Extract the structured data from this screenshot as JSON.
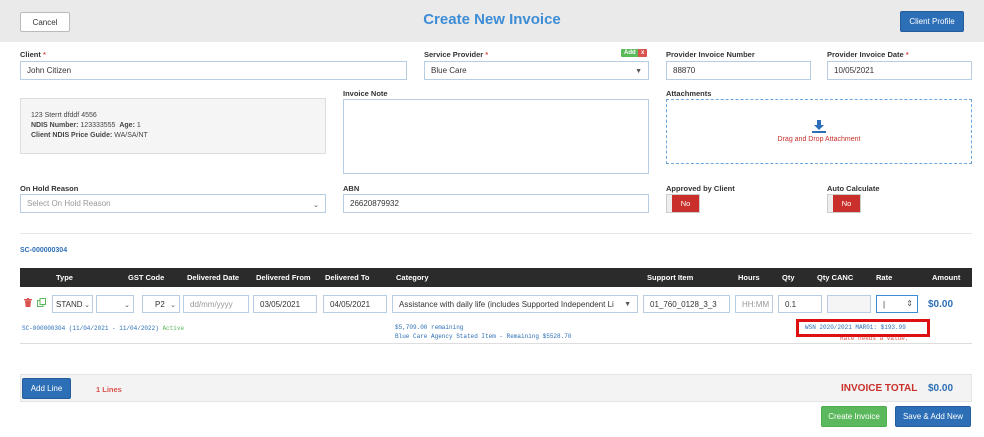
{
  "header": {
    "cancel_label": "Cancel",
    "title": "Create New Invoice",
    "client_profile_label": "Client Profile"
  },
  "form": {
    "client_label": "Client",
    "client_value": "John Citizen",
    "service_provider_label": "Service Provider",
    "service_provider_value": "Blue Care",
    "add_badge": "Add",
    "remove_badge": "x",
    "provider_invoice_number_label": "Provider Invoice Number",
    "provider_invoice_number_value": "88870",
    "provider_invoice_date_label": "Provider Invoice Date",
    "provider_invoice_date_value": "10/05/2021",
    "client_address": "123 Sterrt dfddf 4556",
    "ndis_number_label": "NDIS Number:",
    "ndis_number_value": "123333555",
    "age_label": "Age:",
    "age_value": "1",
    "price_guide_label": "Client NDIS Price Guide:",
    "price_guide_value": "WA/SA/NT",
    "invoice_note_label": "Invoice Note",
    "attachments_label": "Attachments",
    "drag_drop_text": "Drag and Drop Attachment",
    "on_hold_reason_label": "On Hold Reason",
    "on_hold_reason_placeholder": "Select On Hold Reason",
    "abn_label": "ABN",
    "abn_value": "26620879932",
    "approved_by_client_label": "Approved by Client",
    "approved_by_client_value": "No",
    "auto_calculate_label": "Auto Calculate",
    "auto_calculate_value": "No"
  },
  "service_agreement_link": "SC-000000304",
  "table": {
    "headers": {
      "type": "Type",
      "gst_code": "GST Code",
      "delivered_date": "Delivered Date",
      "delivered_from": "Delivered From",
      "delivered_to": "Delivered To",
      "category": "Category",
      "support_item": "Support Item",
      "hours": "Hours",
      "qty": "Qty",
      "qty_canc": "Qty CANC",
      "rate": "Rate",
      "amount": "Amount"
    },
    "row": {
      "type_value": "STAND",
      "gst_code_value": "P2",
      "delivered_date_placeholder": "dd/mm/yyyy",
      "delivered_from_value": "03/05/2021",
      "delivered_to_value": "04/05/2021",
      "category_value": "Assistance with daily life (includes Supported Independent Li",
      "support_item_value": "01_760_0128_3_3",
      "hours_placeholder": "HH:MM",
      "qty_value": "0.1",
      "rate_value": "|",
      "amount_value": "$0.00",
      "agreement_info": "SC-000000304 (11/04/2021 - 11/04/2022)",
      "agreement_status": "Active",
      "remaining_text": "$5,709.00 remaining",
      "stated_item_text": "Blue Care Agency Stated Item - Remaining $5528.70",
      "price_guide_text": "WSN 2020/2021 MAR01: $193.99",
      "rate_error_text": "Rate needs a value."
    }
  },
  "footer": {
    "add_line_label": "Add Line",
    "lines_count": "1 Lines",
    "invoice_total_label": "INVOICE TOTAL",
    "invoice_total_value": "$0.00",
    "create_invoice_label": "Create Invoice",
    "save_add_new_label": "Save & Add New"
  },
  "colors": {
    "primary": "#2d6fb7",
    "title_blue": "#3c8dd6",
    "danger": "#c9302c",
    "success": "#5cb85c",
    "header_dark": "#2b2b2b"
  }
}
